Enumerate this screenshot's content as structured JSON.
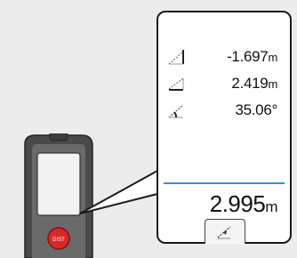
{
  "display": {
    "readings": [
      {
        "icon": "tilt-height-icon",
        "value": "-1.697",
        "unit": "m"
      },
      {
        "icon": "horizontal-distance-icon",
        "value": "2.419",
        "unit": "m"
      },
      {
        "icon": "angle-icon",
        "value": "35.06°",
        "unit": ""
      }
    ],
    "main": {
      "value": "2.995",
      "unit": "m"
    },
    "mode_icon": "smart-horizontal-mode-icon"
  },
  "device": {
    "brand_color": "#d62a2a",
    "body_color": "#555555"
  },
  "colors": {
    "separator": "#3b8ed8"
  }
}
